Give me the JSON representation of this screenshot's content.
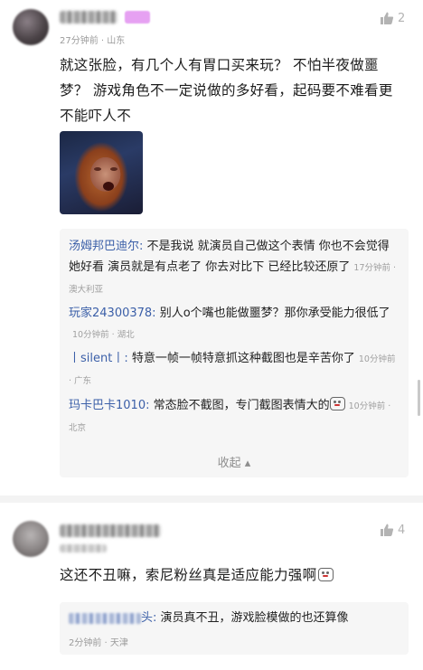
{
  "comment1": {
    "meta": "27分钟前 · 山东",
    "likes": "2",
    "text": "就这张脸，有几个人有胃口买来玩？ 不怕半夜做噩梦？ 游戏角色不一定说做的多好看，起码要不难看更不能吓人不",
    "replies": [
      {
        "name": "汤姆邦巴迪尔",
        "content": "不是我说 就演员自己做这个表情 你也不会觉得她好看 演员就是有点老了 你去对比下 已经比较还原了",
        "meta": "17分钟前 · 澳大利亚"
      },
      {
        "name": "玩家24300378",
        "content": "别人o个嘴也能做噩梦？那你承受能力很低了",
        "meta": "10分钟前 · 湖北"
      },
      {
        "name": "丨silent丨",
        "content": "特意一帧一帧特意抓这种截图也是辛苦你了",
        "meta": "10分钟前 · 广东"
      },
      {
        "name": "玛卡巴卡1010",
        "content": "常态脸不截图，专门截图表情大的",
        "meta": "10分钟前 · 北京"
      }
    ],
    "collapse_label": "收起 ▴"
  },
  "comment2": {
    "likes": "4",
    "text": "这还不丑嘛，索尼粉丝真是适应能力强啊",
    "reply": {
      "name_suffix": "头",
      "content": "演员真不丑，游戏脸模做的也还算像",
      "meta": "2分钟前 · 天津"
    }
  },
  "icons": {
    "like": "thumbs-up-icon",
    "emoji": "laughing-emoji-icon"
  }
}
